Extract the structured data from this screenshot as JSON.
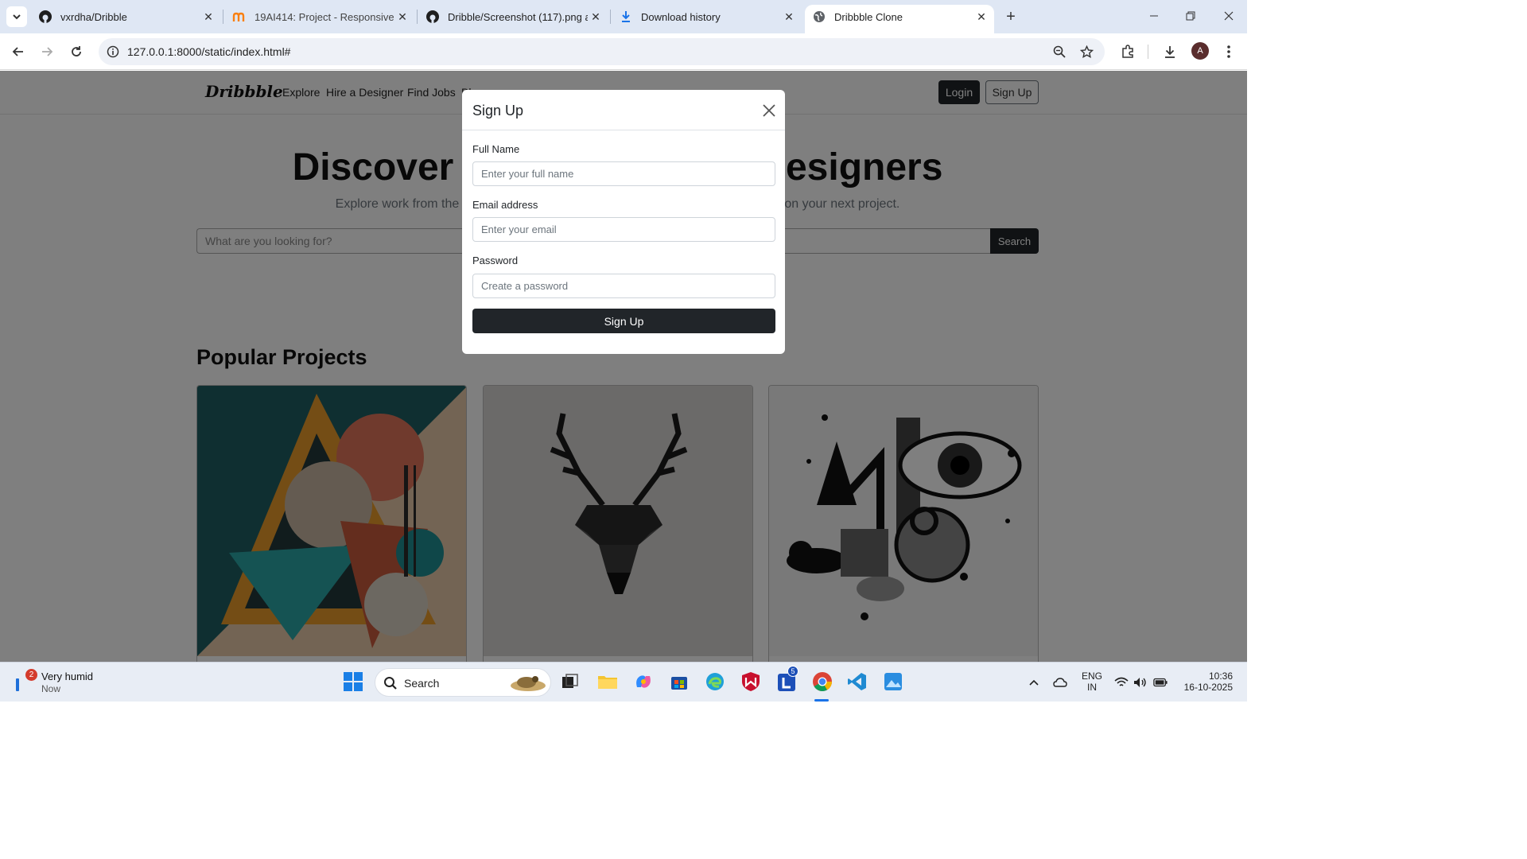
{
  "browser": {
    "tabs": [
      {
        "title": "vxrdha/Dribble",
        "favicon": "github-icon"
      },
      {
        "title": "19AI414: Project - Responsive W",
        "favicon": "moodle-icon"
      },
      {
        "title": "Dribble/Screenshot (117).png at",
        "favicon": "github-icon"
      },
      {
        "title": "Download history",
        "favicon": "download-icon"
      },
      {
        "title": "Dribbble Clone",
        "favicon": "globe-icon",
        "active": true
      }
    ],
    "url": "127.0.0.1:8000/static/index.html#",
    "profile_initial": "A"
  },
  "site": {
    "brand": "Dribbble",
    "nav_links": [
      "Explore",
      "Hire a Designer",
      "Find Jobs",
      "Bl"
    ],
    "login_label": "Login",
    "signup_label": "Sign Up",
    "hero_title": "Discover the World's Top Designers",
    "hero_subtitle": "Explore work from the most talented and accomplished designers ready to take on your next project.",
    "search_placeholder": "What are you looking for?",
    "search_button": "Search",
    "section_title": "Popular Projects"
  },
  "modal": {
    "title": "Sign Up",
    "fields": [
      {
        "label": "Full Name",
        "placeholder": "Enter your full name"
      },
      {
        "label": "Email address",
        "placeholder": "Enter your email"
      },
      {
        "label": "Password",
        "placeholder": "Create a password"
      }
    ],
    "submit_label": "Sign Up"
  },
  "taskbar": {
    "weather_badge": "2",
    "weather_title": "Very humid",
    "weather_sub": "Now",
    "search_label": "Search",
    "lang_line1": "ENG",
    "lang_line2": "IN",
    "time": "10:36",
    "date": "16-10-2025",
    "l_badge": "5"
  }
}
